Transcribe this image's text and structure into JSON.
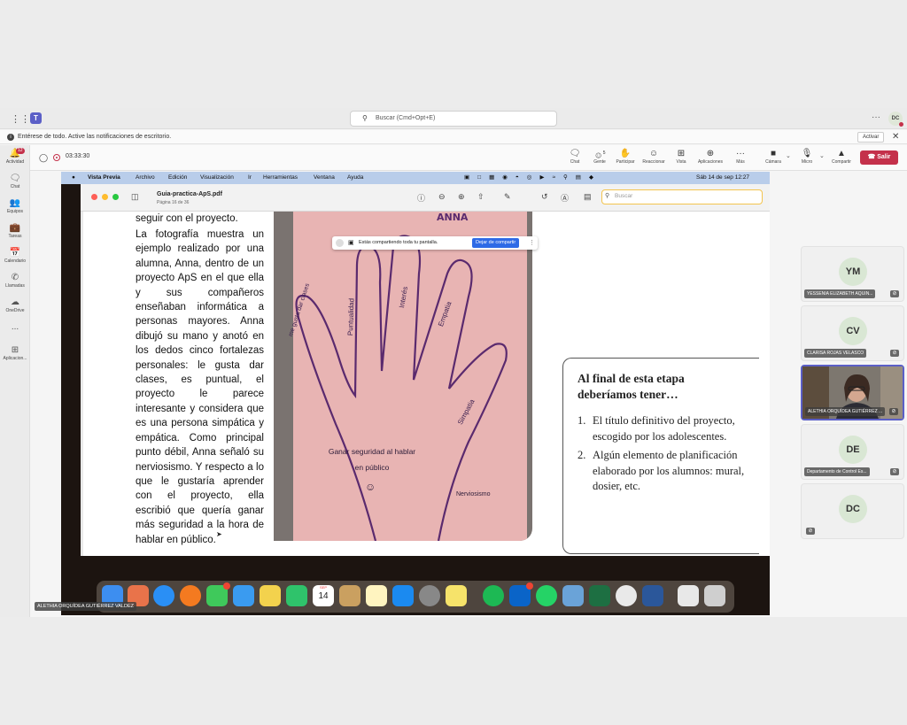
{
  "app": {
    "search_placeholder": "Buscar (Cmd+Opt+E)",
    "user_initials": "DC",
    "teams_logo_letter": "T"
  },
  "notification": {
    "text": "Entérese de todo. Active las notificaciones de escritorio.",
    "activate_label": "Activar"
  },
  "rail": {
    "items": [
      {
        "label": "Actividad",
        "icon": "bell-icon",
        "badge": "12"
      },
      {
        "label": "Chat",
        "icon": "chat-icon"
      },
      {
        "label": "Equipos",
        "icon": "teams-icon"
      },
      {
        "label": "Tareas",
        "icon": "tasks-icon"
      },
      {
        "label": "Calendario",
        "icon": "calendar-icon"
      },
      {
        "label": "Llamadas",
        "icon": "phone-icon"
      },
      {
        "label": "OneDrive",
        "icon": "cloud-icon"
      },
      {
        "label": "...",
        "icon": "more-icon"
      },
      {
        "label": "Aplicacion...",
        "icon": "apps-icon"
      }
    ]
  },
  "meeting": {
    "timer": "03:33:30",
    "people_count": "5",
    "tools": [
      {
        "label": "Chat",
        "icon": "chat-icon"
      },
      {
        "label": "Gente",
        "icon": "people-icon"
      },
      {
        "label": "Participar",
        "icon": "raise-hand-icon"
      },
      {
        "label": "Reaccionar",
        "icon": "smile-icon"
      },
      {
        "label": "Vista",
        "icon": "grid-view-icon"
      },
      {
        "label": "Aplicaciones",
        "icon": "apps-add-icon"
      },
      {
        "label": "Más",
        "icon": "more-icon"
      },
      {
        "label": "Cámara",
        "icon": "camera-off-icon"
      },
      {
        "label": "Micro",
        "icon": "mic-off-icon"
      },
      {
        "label": "Compartir",
        "icon": "share-icon"
      }
    ],
    "leave_label": "Salir"
  },
  "mac": {
    "menu": [
      "Vista Previa",
      "Archivo",
      "Edición",
      "Visualización",
      "Ir",
      "Herramientas",
      "Ventana",
      "Ayuda"
    ],
    "datetime": "Sáb 14 de sep   12:27"
  },
  "preview": {
    "filename": "Guia-practica-ApS.pdf",
    "page_info": "Página 16 de 36",
    "search_placeholder": "Buscar"
  },
  "share_banner": {
    "text": "Estás compartiendo toda tu pantalla.",
    "stop_label": "Dejar de compartir"
  },
  "document": {
    "top_line": "seguir con el proyecto.",
    "paragraph": "La fotografía muestra un ejemplo realizado por una alumna, Anna, dentro de un proyecto ApS en el que ella y sus compañeros enseñaban informática a personas mayores. Anna dibujó su mano y anotó en los dedos cinco fortalezas personales: le gusta dar clases, es puntual, el proyecto le parece interesante y considera que es una persona simpática y empática. Como principal punto débil, Anna señaló su nerviosismo. Y respecto a lo que le gustaría aprender con el proyecto, ella escribió que quería ganar más seguridad a la hora de hablar en público.",
    "photo": {
      "name_label": "ANNA",
      "fingers": [
        "me gusta dar clases",
        "Puntualidad",
        "Interés",
        "Empatia",
        "Simpatia"
      ],
      "palm": "Ganar seguridad al hablar en público",
      "weakness": "Nerviosismo"
    },
    "box_title": "Al final de esta etapa deberíamos tener…",
    "box_items": [
      {
        "n": "1.",
        "text": "El título definitivo del proyecto, escogido por los adolescentes."
      },
      {
        "n": "2.",
        "text": "Algún elemento de planificación elaborado por los alumnos: mural, dosier, etc."
      }
    ]
  },
  "dock": {
    "calendar_day": "14",
    "calendar_month": "SEP"
  },
  "participants": [
    {
      "initials": "YM",
      "name": "YESSENIA ELIZABETH AQUIN...",
      "muted": true
    },
    {
      "initials": "CV",
      "name": "CLARISA ROJAS VELASCO",
      "muted": true
    },
    {
      "initials": "",
      "name": "ALETHIA ORQUÍDEA GUTIÉRREZ ...",
      "muted": true,
      "video": true
    },
    {
      "initials": "DE",
      "name": "Departamento de Control Es...",
      "muted": true
    },
    {
      "initials": "DC",
      "name": "",
      "muted": true
    }
  ],
  "presenter_label": "ALETHIA ORQUÍDEA GUTIÉRREZ VALDEZ",
  "colors": {
    "teams_purple": "#5b5fc7",
    "leave_red": "#c4314b",
    "mac_menu": "#b9cdea",
    "paper_pink": "#e8b4b3",
    "ink_purple": "#5a2a6e"
  }
}
